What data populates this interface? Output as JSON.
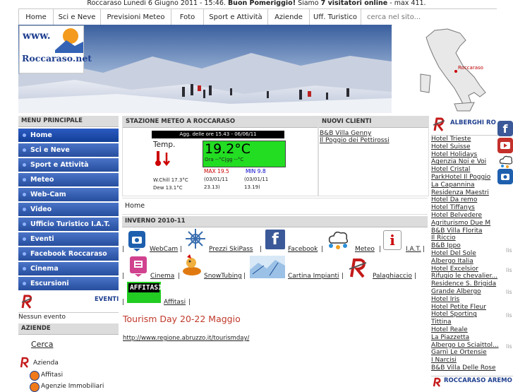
{
  "header": {
    "prefix": "Roccaraso Lunedi 6 Giugno 2011 - 15:46.",
    "greeting": "Buon Pomeriggio!",
    "mid": "Siamo",
    "online": "7 visitatori online",
    "suffix": "- max 411."
  },
  "nav": {
    "items": [
      "Home",
      "Sci e Neve",
      "Previsioni Meteo",
      "Foto",
      "Sport e Attività",
      "Aziende",
      "Uff. Turistico"
    ],
    "search_placeholder": "cerca nel sito..."
  },
  "logo": {
    "text_top": "www.",
    "text_bottom": "Roccaraso.net"
  },
  "map": {
    "label": "Roccaraso"
  },
  "menu": {
    "title": "MENU PRINCIPALE",
    "items": [
      "Home",
      "Sci e Neve",
      "Sport e Attività",
      "Meteo",
      "Web-Cam",
      "Video",
      "Ufficio Turistico I.A.T.",
      "Eventi",
      "Facebook Roccaraso",
      "Cinema",
      "Escursioni"
    ]
  },
  "eventi": {
    "label": "EVENTI",
    "none": "Nessun evento"
  },
  "aziende": {
    "title": "AZIENDE",
    "cerca": "Cerca",
    "azienda": "Azienda",
    "affitasi": "Affitasi",
    "next": "Agenzie Immobiliari"
  },
  "meteo": {
    "title": "STAZIONE METEO A ROCCARASO",
    "updated": "Agg. delle ore 15.43 - 06/06/11",
    "temp_label": "Temp.",
    "temp": "19.2°C",
    "ora": "Ora --°C|gg --°C",
    "wchill": "W.Chill  17.3°C",
    "dew": "Dew 13.1°C",
    "max": "MAX 19.5",
    "max_when": "(03/01/11 23.13)",
    "min": "MIN 9.8",
    "min_when": "(03/01/11 13.19)"
  },
  "nuovi": {
    "title": "NUOVI CLIENTI",
    "items": [
      "B&B Villa Genny",
      "Il Poggio dei Pettirossi"
    ]
  },
  "breadcrumb": "Home",
  "inverno": {
    "title": "INVERNO 2010-11",
    "row1": [
      "WebCam",
      "Prezzi SkiPass",
      "Facebook",
      "Meteo",
      "I.A.T."
    ],
    "row2": [
      "Cinema",
      "SnowTubing",
      "Cartina Impianti",
      "Palaghiaccio"
    ],
    "row3": [
      "Affitasi"
    ],
    "affitasi_badge": "AFFITASI"
  },
  "article": {
    "title": "Tourism Day 20-22 Maggio",
    "url": "http://www.regione.abruzzo.it/tourismday/"
  },
  "alberghi": {
    "title": "ALBERGHI RO",
    "items": [
      "Hotel Trieste",
      "Hotel Suisse",
      "Hotel Holidays",
      "Agenzia Noi e Voi",
      "Hotel Cristal",
      "ParkHotel Il Poggio",
      "La Capannina",
      "Residenza Maestri",
      "Hotel Da remo",
      "Hotel Tiffanys",
      "Hotel Belvedere",
      "Agriturismo Due M",
      "B&B Villa Florita",
      "Il Riccio",
      "B&B Ippo",
      "Hotel Del Sole",
      "Albergo Italia",
      "Hotel Excelsior",
      "Rifugio le chevalier...",
      "Residence S. Brigida",
      "Grande Albergo",
      "Hotel Iris",
      "Hotel Petite Fleur",
      "Hotel Sporting",
      "Tittina",
      "Hotel Reale",
      "La Piazzetta",
      "Albergo Lo Sciaittol...",
      "Garnì Le Ortensie",
      "I Narcisi",
      "B&B Villa Delle Rose"
    ],
    "bottom": "ROCCARASO AREMO",
    "side_marks": [
      "lis",
      "lis",
      "lis",
      "lis",
      "lis"
    ]
  }
}
